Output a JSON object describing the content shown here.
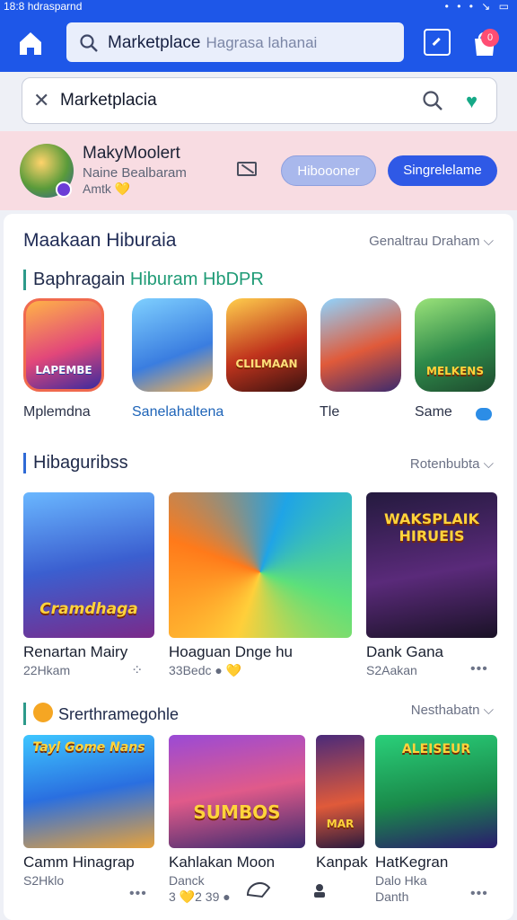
{
  "status": {
    "time": "18:8 hdrasparnd",
    "icons": "• • •  ↘ ▭"
  },
  "topbar": {
    "search_query": "Marketplace",
    "search_hint": "Hagrasa lahanai",
    "badge": "0",
    "home_icon": "home-icon",
    "bag_icon": "shopping-bag-icon"
  },
  "sub_search": {
    "value": "Marketplacia"
  },
  "banner": {
    "name": "MakyMoolert",
    "line1": "Naine Bealbaram",
    "line2": "Amtk 💛",
    "secondary_button": "Hiboooner",
    "primary_button": "Singrelelame"
  },
  "main": {
    "title": "Maakaan Hiburaia",
    "see_all": "Genaltrau Draham ⌵",
    "featured": {
      "label_a": "Baphragain ",
      "label_b": "Hiburam HbDPR",
      "apps": [
        {
          "name": "Mplemdna",
          "art": "LAPEMBE"
        },
        {
          "name": "Sanelahaltena",
          "art": ""
        },
        {
          "name": "",
          "art": "CLILMAAN"
        },
        {
          "name": "Tle",
          "art": ""
        },
        {
          "name": "Same",
          "art": "MELKENS"
        }
      ]
    },
    "section2": {
      "label": "Hibaguribss",
      "more": "Rotenbubta ⌵",
      "items": [
        {
          "title": "Renartan Mairy",
          "meta": "22Hkam",
          "art": "Cramdhaga"
        },
        {
          "title": "Hoaguan Dnge hu",
          "meta": "33Bedc ● 💛",
          "art": ""
        },
        {
          "title": "Dank Gana",
          "meta": "S2Aakan",
          "art": "WAKSPLAIK HIRUEIS"
        }
      ]
    },
    "section3": {
      "label": "Srerthramegohle",
      "more": "Nesthabatn ⌵",
      "items": [
        {
          "title": "Camm Hinagrap",
          "meta": "S2Hklo",
          "art": "Tayl Gome Nans"
        },
        {
          "title": "Kahlakan Moon",
          "meta": "Danck",
          "meta2": "3 💛2 39 ●",
          "art": "SUMBOS"
        },
        {
          "title": "Kanpak",
          "meta": "",
          "art": "MAR"
        },
        {
          "title": "HatKegran",
          "meta": "Dalo Hka",
          "meta2": "Danth",
          "art": "ALEISEUR"
        }
      ]
    }
  }
}
